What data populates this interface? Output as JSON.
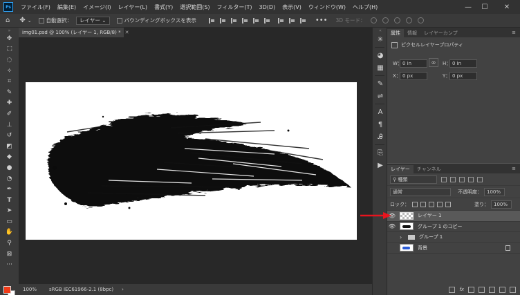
{
  "menubar": {
    "logo": "Ps",
    "items": [
      "ファイル(F)",
      "編集(E)",
      "イメージ(I)",
      "レイヤー(L)",
      "書式(Y)",
      "選択範囲(S)",
      "フィルター(T)",
      "3D(D)",
      "表示(V)",
      "ウィンドウ(W)",
      "ヘルプ(H)"
    ],
    "window_controls": [
      "—",
      "☐",
      "✕"
    ]
  },
  "options": {
    "auto_select_label": "自動選択：",
    "auto_select_value": "レイヤー",
    "bounding_box_label": "バウンディングボックスを表示",
    "mode_3d_label": "3D モード："
  },
  "document": {
    "tab_title": "img01.psd @ 100% (レイヤー 1, RGB/8) *",
    "zoom": "100%",
    "color_profile": "sRGB IEC61966-2.1 (8bpc)",
    "status_arrow": "›"
  },
  "properties": {
    "tabs": [
      "属性",
      "情報",
      "レイヤーカンプ"
    ],
    "section_label": "ピクセルレイヤープロパティ",
    "w_key": "W：",
    "w_val": "0 in",
    "h_key": "H：",
    "h_val": "0 in",
    "x_key": "X：",
    "x_val": "0 px",
    "y_key": "Y：",
    "y_val": "0 px"
  },
  "layers": {
    "tabs": [
      "レイヤー",
      "チャンネル"
    ],
    "filter_kind": "種類",
    "blend_mode": "通常",
    "opacity_label": "不透明度：",
    "opacity_value": "100%",
    "lock_label": "ロック：",
    "fill_label": "塗り：",
    "fill_value": "100%",
    "items": [
      {
        "name": "レイヤー 1",
        "visible": true,
        "selected": true
      },
      {
        "name": "グループ 1 のコピー",
        "visible": true,
        "selected": false
      },
      {
        "name": "グループ 1",
        "visible": false,
        "selected": false
      },
      {
        "name": "背景",
        "visible": false,
        "selected": false
      }
    ],
    "footer_fx": "fx"
  },
  "colors": {
    "foreground": "#f03a17",
    "background": "#ffffff",
    "annotation_arrow": "#e8141e"
  }
}
